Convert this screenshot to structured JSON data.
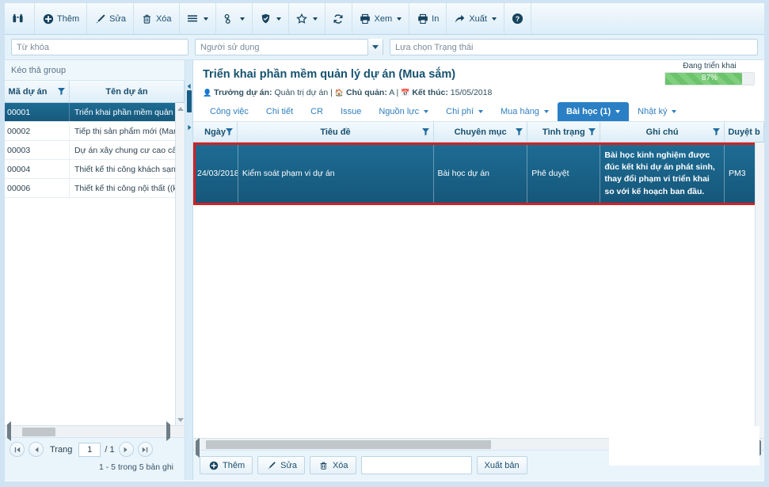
{
  "toolbar": {
    "items": [
      {
        "name": "search-binoculars",
        "icon": "binoculars-icon",
        "label": "",
        "caret": false
      },
      {
        "name": "add",
        "icon": "plus-circle-icon",
        "label": "Thêm",
        "caret": false
      },
      {
        "name": "edit",
        "icon": "pencil-icon",
        "label": "Sửa",
        "caret": false
      },
      {
        "name": "delete",
        "icon": "trash-icon",
        "label": "Xóa",
        "caret": false
      },
      {
        "name": "list",
        "icon": "hamburger-icon",
        "label": "",
        "caret": true
      },
      {
        "name": "link",
        "icon": "link-icon",
        "label": "",
        "caret": true
      },
      {
        "name": "approve",
        "icon": "shield-check-icon",
        "label": "",
        "caret": true
      },
      {
        "name": "favorite",
        "icon": "star-icon",
        "label": "",
        "caret": true
      },
      {
        "name": "refresh",
        "icon": "refresh-icon",
        "label": "",
        "caret": false
      },
      {
        "name": "preview",
        "icon": "printer-icon",
        "label": "Xem",
        "caret": true
      },
      {
        "name": "print",
        "icon": "printer-icon",
        "label": "In",
        "caret": false
      },
      {
        "name": "export",
        "icon": "share-arrow-icon",
        "label": "Xuất",
        "caret": true
      },
      {
        "name": "help",
        "icon": "question-circle-icon",
        "label": "",
        "caret": false
      }
    ]
  },
  "filters": {
    "keyword_placeholder": "Từ khóa",
    "keyword_value": "",
    "user_value": "Người sử dụng",
    "status_placeholder": "Lựa chọn Trạng thái",
    "status_value": ""
  },
  "left_panel": {
    "group_bar": "Kéo thả group",
    "columns": [
      "Mã dự án",
      "Tên dự án"
    ],
    "rows": [
      {
        "code": "00001",
        "name": "Triển khai phần mềm quản lý dự án (",
        "selected": true
      },
      {
        "code": "00002",
        "name": "Tiếp thị sản phẩm mới (Marketing)",
        "selected": false
      },
      {
        "code": "00003",
        "name": "Dự án xây chung cư cao cấp A (Xây ",
        "selected": false
      },
      {
        "code": "00004",
        "name": "Thiết kế thi công khách sạn B (Xây lắ",
        "selected": false
      },
      {
        "code": "00006",
        "name": "Thiết kế thi công nội thất ((kiến trúc)",
        "selected": false
      }
    ],
    "pager": {
      "label": "Trang",
      "page": "1",
      "total": "/ 1",
      "summary": "1 - 5 trong 5 bản ghi"
    }
  },
  "project": {
    "title": "Triển khai phần mềm quản lý dự án (Mua sắm)",
    "meta_manager_label": "Trưởng dự án:",
    "meta_manager_value": "Quản trị dự án",
    "meta_owner_label": "Chủ quản:",
    "meta_owner_value": "A",
    "meta_end_label": "Kết thúc:",
    "meta_end_value": "15/05/2018",
    "progress_label": "Đang triển khai",
    "progress_percent": "87%",
    "progress_value": 87,
    "progress_color": "#6cc36c"
  },
  "tabs": [
    {
      "label": "Công việc",
      "caret": false,
      "active": false
    },
    {
      "label": "Chi tiết",
      "caret": false,
      "active": false
    },
    {
      "label": "CR",
      "caret": false,
      "active": false
    },
    {
      "label": "Issue",
      "caret": false,
      "active": false
    },
    {
      "label": "Nguồn lực",
      "caret": true,
      "active": false
    },
    {
      "label": "Chi phí",
      "caret": true,
      "active": false
    },
    {
      "label": "Mua hàng",
      "caret": true,
      "active": false
    },
    {
      "label": "Bài học (1)",
      "caret": true,
      "active": true
    },
    {
      "label": "Nhật ký",
      "caret": true,
      "active": false
    }
  ],
  "grid": {
    "columns": [
      "Ngày",
      "Tiêu đề",
      "Chuyên mục",
      "Tình trạng",
      "Ghi chú",
      "Duyệt b"
    ],
    "rows": [
      {
        "date": "24/03/2018",
        "title": "Kiểm soát phạm vi dự án",
        "category": "Bài học dự án",
        "status": "Phê duyệt",
        "note": "Bài học kinh nghiệm được đúc kết khi dự án phát sinh, thay đổi phạm vi triển khai so với kế hoạch ban đầu.",
        "approver": "PM3",
        "selected": true
      }
    ]
  },
  "footer": {
    "add_label": "Thêm",
    "edit_label": "Sửa",
    "delete_label": "Xóa",
    "search_value": "",
    "publish_label": "Xuất bản"
  },
  "colors": {
    "accent": "#2b7fc4",
    "selection": "#1d6c94",
    "highlight_border": "#d32020",
    "progress": "#6cc36c"
  }
}
